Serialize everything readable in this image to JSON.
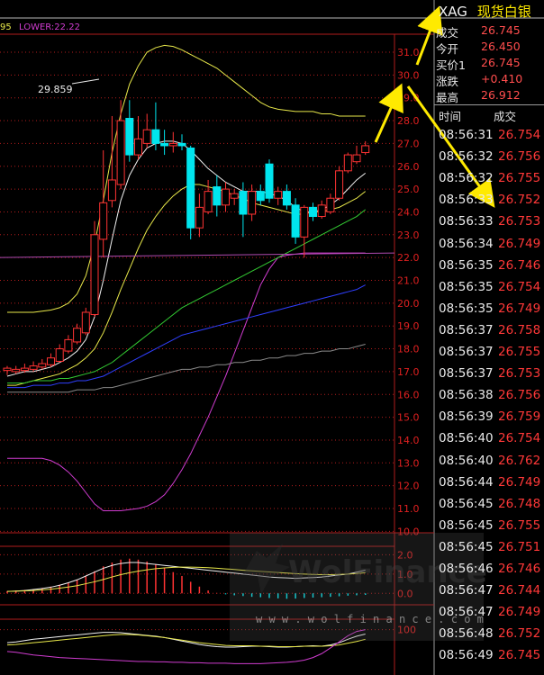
{
  "header": {
    "indicator_tail": "95",
    "lower_label": "LOWER:22.22",
    "annotation_high": "29.859"
  },
  "symbol": {
    "code": "XAG",
    "name": "现货白银"
  },
  "quote": [
    {
      "label": "成交",
      "value": "26.745"
    },
    {
      "label": "今开",
      "value": "26.450"
    },
    {
      "label": "买价1",
      "value": "26.745"
    },
    {
      "label": "涨跌",
      "value": "+0.410"
    },
    {
      "label": "最高",
      "value": "26.912"
    }
  ],
  "ticks_header": {
    "time": "时间",
    "price": "成交"
  },
  "ticks": [
    {
      "time": "08:56:31",
      "price": "26.754"
    },
    {
      "time": "08:56:32",
      "price": "26.756"
    },
    {
      "time": "08:56:32",
      "price": "26.755"
    },
    {
      "time": "08:56:33",
      "price": "26.752"
    },
    {
      "time": "08:56:33",
      "price": "26.753"
    },
    {
      "time": "08:56:34",
      "price": "26.749"
    },
    {
      "time": "08:56:35",
      "price": "26.746"
    },
    {
      "time": "08:56:35",
      "price": "26.754"
    },
    {
      "time": "08:56:35",
      "price": "26.749"
    },
    {
      "time": "08:56:37",
      "price": "26.758"
    },
    {
      "time": "08:56:37",
      "price": "26.755"
    },
    {
      "time": "08:56:37",
      "price": "26.753"
    },
    {
      "time": "08:56:38",
      "price": "26.756"
    },
    {
      "time": "08:56:39",
      "price": "26.759"
    },
    {
      "time": "08:56:40",
      "price": "26.754"
    },
    {
      "time": "08:56:40",
      "price": "26.762"
    },
    {
      "time": "08:56:44",
      "price": "26.749"
    },
    {
      "time": "08:56:45",
      "price": "26.748"
    },
    {
      "time": "08:56:45",
      "price": "26.755"
    },
    {
      "time": "08:56:45",
      "price": "26.751"
    },
    {
      "time": "08:56:46",
      "price": "26.746"
    },
    {
      "time": "08:56:47",
      "price": "26.744"
    },
    {
      "time": "08:56:47",
      "price": "26.749"
    },
    {
      "time": "08:56:48",
      "price": "26.752"
    },
    {
      "time": "08:56:49",
      "price": "26.745"
    }
  ],
  "watermark": {
    "brand": "WolFinance",
    "url": "w w w . w o l f i n a n c e . c o m"
  },
  "colors": {
    "up": "#ff3333",
    "down": "#00e5ee",
    "grid": "#b01c1c",
    "axis_label": "#e02020",
    "upper_band": "#e8e84a",
    "lower_band": "#d03cd0",
    "ma_white": "#f2f2f2",
    "ma_yellow": "#e8e84a",
    "ma_green": "#33cc33",
    "ma_blue": "#2f3fff",
    "ma_gray": "#8a8a8a",
    "arrow": "#ffea00"
  },
  "chart_data": {
    "type": "candlestick",
    "y_ticks": [
      31.0,
      30.0,
      29.0,
      28.0,
      27.0,
      26.0,
      25.0,
      24.0,
      23.0,
      22.0,
      21.0,
      20.0,
      19.0,
      18.0,
      17.0,
      16.0,
      15.0,
      14.0,
      13.0,
      12.0,
      11.0,
      10.0
    ],
    "ylim": [
      10.0,
      31.0
    ],
    "candles": [
      {
        "o": 17.05,
        "c": 17.15,
        "h": 17.25,
        "l": 16.85
      },
      {
        "o": 17.0,
        "c": 17.1,
        "h": 17.25,
        "l": 16.9
      },
      {
        "o": 17.05,
        "c": 17.15,
        "h": 17.35,
        "l": 16.95
      },
      {
        "o": 17.1,
        "c": 17.25,
        "h": 17.45,
        "l": 17.0
      },
      {
        "o": 17.2,
        "c": 17.35,
        "h": 17.55,
        "l": 17.1
      },
      {
        "o": 17.3,
        "c": 17.6,
        "h": 17.8,
        "l": 17.2
      },
      {
        "o": 17.45,
        "c": 18.0,
        "h": 18.2,
        "l": 17.4
      },
      {
        "o": 17.9,
        "c": 18.4,
        "h": 18.6,
        "l": 17.8
      },
      {
        "o": 18.3,
        "c": 18.9,
        "h": 19.1,
        "l": 18.2
      },
      {
        "o": 18.7,
        "c": 19.6,
        "h": 19.8,
        "l": 18.6
      },
      {
        "o": 19.5,
        "c": 23.0,
        "h": 23.6,
        "l": 19.4
      },
      {
        "o": 22.8,
        "c": 24.4,
        "h": 26.7,
        "l": 22.0
      },
      {
        "o": 24.5,
        "c": 25.4,
        "h": 28.2,
        "l": 24.2
      },
      {
        "o": 25.2,
        "c": 28.0,
        "h": 28.9,
        "l": 25.0
      },
      {
        "o": 28.1,
        "c": 26.5,
        "h": 28.9,
        "l": 26.2
      },
      {
        "o": 26.5,
        "c": 27.2,
        "h": 28.2,
        "l": 26.3
      },
      {
        "o": 27.0,
        "c": 27.6,
        "h": 28.3,
        "l": 26.8
      },
      {
        "o": 27.6,
        "c": 27.0,
        "h": 28.8,
        "l": 26.7
      },
      {
        "o": 27.0,
        "c": 26.9,
        "h": 27.6,
        "l": 26.5
      },
      {
        "o": 26.9,
        "c": 27.0,
        "h": 27.5,
        "l": 26.6
      },
      {
        "o": 27.0,
        "c": 26.9,
        "h": 27.4,
        "l": 26.7
      },
      {
        "o": 26.8,
        "c": 23.3,
        "h": 26.9,
        "l": 22.8
      },
      {
        "o": 23.3,
        "c": 24.2,
        "h": 24.8,
        "l": 22.9
      },
      {
        "o": 24.0,
        "c": 24.9,
        "h": 25.4,
        "l": 23.9
      },
      {
        "o": 25.1,
        "c": 24.3,
        "h": 25.6,
        "l": 23.8
      },
      {
        "o": 24.3,
        "c": 25.0,
        "h": 25.3,
        "l": 24.0
      },
      {
        "o": 24.6,
        "c": 24.8,
        "h": 25.0,
        "l": 24.3
      },
      {
        "o": 24.9,
        "c": 23.9,
        "h": 25.3,
        "l": 22.9
      },
      {
        "o": 23.9,
        "c": 24.9,
        "h": 25.2,
        "l": 23.6
      },
      {
        "o": 24.9,
        "c": 24.5,
        "h": 25.2,
        "l": 24.3
      },
      {
        "o": 26.1,
        "c": 24.6,
        "h": 26.3,
        "l": 24.4
      },
      {
        "o": 24.6,
        "c": 24.9,
        "h": 25.1,
        "l": 24.3
      },
      {
        "o": 24.9,
        "c": 24.3,
        "h": 25.2,
        "l": 24.1
      },
      {
        "o": 24.3,
        "c": 22.9,
        "h": 24.6,
        "l": 22.6
      },
      {
        "o": 22.9,
        "c": 24.2,
        "h": 24.3,
        "l": 22.0
      },
      {
        "o": 24.2,
        "c": 23.8,
        "h": 24.4,
        "l": 23.6
      },
      {
        "o": 23.8,
        "c": 24.3,
        "h": 24.5,
        "l": 23.7
      },
      {
        "o": 24.0,
        "c": 24.6,
        "h": 24.8,
        "l": 23.9
      },
      {
        "o": 24.6,
        "c": 25.8,
        "h": 26.0,
        "l": 24.5
      },
      {
        "o": 25.8,
        "c": 26.5,
        "h": 26.6,
        "l": 25.7
      },
      {
        "o": 26.2,
        "c": 26.5,
        "h": 26.9,
        "l": 26.1
      },
      {
        "o": 26.6,
        "c": 26.9,
        "h": 27.1,
        "l": 26.5
      }
    ],
    "overlays": [
      {
        "name": "upper_band",
        "color": "#e8e84a",
        "values": [
          19.6,
          19.6,
          19.6,
          19.6,
          19.65,
          19.7,
          19.8,
          20.0,
          20.4,
          21.2,
          22.6,
          24.5,
          26.6,
          28.3,
          29.6,
          30.4,
          31.0,
          31.2,
          31.3,
          31.25,
          31.1,
          30.9,
          30.7,
          30.5,
          30.3,
          30.0,
          29.7,
          29.4,
          29.1,
          28.8,
          28.6,
          28.5,
          28.45,
          28.4,
          28.4,
          28.4,
          28.3,
          28.3,
          28.2,
          28.2,
          28.2,
          28.2
        ]
      },
      {
        "name": "lower_band",
        "color": "#d03cd0",
        "values": [
          13.2,
          13.2,
          13.2,
          13.2,
          13.2,
          13.1,
          12.9,
          12.6,
          12.2,
          11.7,
          11.2,
          10.9,
          10.9,
          10.9,
          10.95,
          11.0,
          11.1,
          11.3,
          11.6,
          12.1,
          12.7,
          13.4,
          14.2,
          15.0,
          15.9,
          16.8,
          17.8,
          18.8,
          19.8,
          20.8,
          21.5,
          22.0,
          22.1,
          22.15,
          22.2,
          22.2,
          22.2,
          22.2,
          22.2,
          22.2,
          22.2,
          22.2
        ]
      },
      {
        "name": "ma_white",
        "color": "#f2f2f2",
        "values": [
          16.8,
          16.9,
          17.0,
          17.0,
          17.1,
          17.2,
          17.4,
          17.6,
          17.9,
          18.4,
          19.4,
          21.0,
          22.8,
          24.5,
          25.6,
          26.3,
          26.8,
          27.0,
          27.1,
          27.1,
          27.0,
          26.7,
          26.3,
          25.9,
          25.6,
          25.3,
          25.1,
          24.9,
          24.9,
          24.9,
          24.8,
          24.7,
          24.5,
          24.2,
          24.0,
          24.0,
          24.1,
          24.3,
          24.6,
          25.0,
          25.4,
          25.7
        ]
      },
      {
        "name": "ma_yellow",
        "color": "#e8e84a",
        "values": [
          16.4,
          16.4,
          16.5,
          16.6,
          16.7,
          16.8,
          16.9,
          17.1,
          17.3,
          17.6,
          18.0,
          18.7,
          19.6,
          20.6,
          21.5,
          22.4,
          23.2,
          23.8,
          24.3,
          24.7,
          25.0,
          25.2,
          25.2,
          25.1,
          25.0,
          24.9,
          24.7,
          24.6,
          24.4,
          24.3,
          24.2,
          24.1,
          24.0,
          23.9,
          23.9,
          24.0,
          24.0,
          24.1,
          24.2,
          24.4,
          24.6,
          24.9
        ]
      },
      {
        "name": "ma_green",
        "color": "#33cc33",
        "values": [
          16.5,
          16.5,
          16.5,
          16.6,
          16.6,
          16.6,
          16.7,
          16.7,
          16.8,
          16.9,
          17.0,
          17.2,
          17.4,
          17.7,
          18.0,
          18.3,
          18.6,
          18.9,
          19.2,
          19.5,
          19.8,
          20.0,
          20.2,
          20.4,
          20.6,
          20.8,
          21.0,
          21.2,
          21.4,
          21.6,
          21.8,
          22.0,
          22.2,
          22.4,
          22.6,
          22.8,
          23.0,
          23.2,
          23.4,
          23.6,
          23.8,
          24.1
        ]
      },
      {
        "name": "ma_blue",
        "color": "#2f3fff",
        "values": [
          16.3,
          16.3,
          16.3,
          16.4,
          16.4,
          16.4,
          16.5,
          16.5,
          16.6,
          16.6,
          16.7,
          16.8,
          17.0,
          17.2,
          17.4,
          17.6,
          17.8,
          18.0,
          18.2,
          18.4,
          18.6,
          18.7,
          18.8,
          18.9,
          19.0,
          19.1,
          19.2,
          19.3,
          19.4,
          19.5,
          19.6,
          19.7,
          19.8,
          19.9,
          20.0,
          20.1,
          20.2,
          20.3,
          20.4,
          20.5,
          20.6,
          20.8
        ]
      },
      {
        "name": "ma_gray",
        "color": "#8a8a8a",
        "values": [
          16.1,
          16.1,
          16.1,
          16.1,
          16.1,
          16.1,
          16.1,
          16.1,
          16.2,
          16.2,
          16.2,
          16.3,
          16.3,
          16.4,
          16.5,
          16.6,
          16.7,
          16.8,
          16.9,
          17.0,
          17.1,
          17.1,
          17.2,
          17.2,
          17.3,
          17.3,
          17.4,
          17.4,
          17.5,
          17.5,
          17.6,
          17.6,
          17.7,
          17.7,
          17.8,
          17.8,
          17.9,
          17.9,
          18.0,
          18.0,
          18.1,
          18.2
        ]
      }
    ],
    "support_line": {
      "from": 22.0,
      "to": 22.2,
      "color": "#b04ab0"
    },
    "macd": {
      "y_ticks": [
        2.0,
        1.0,
        0.0
      ],
      "ylim": [
        -0.5,
        2.3
      ],
      "histogram": [
        0.12,
        0.15,
        0.18,
        0.22,
        0.28,
        0.35,
        0.45,
        0.55,
        0.7,
        0.9,
        1.15,
        1.4,
        1.6,
        1.75,
        1.8,
        1.75,
        1.65,
        1.5,
        1.3,
        1.1,
        0.9,
        0.6,
        0.35,
        0.15,
        0.02,
        -0.05,
        -0.1,
        -0.14,
        -0.18,
        -0.2,
        -0.24,
        -0.26,
        -0.28,
        -0.27,
        -0.24,
        -0.22,
        -0.2,
        -0.18,
        -0.15,
        -0.12,
        -0.1,
        -0.08
      ],
      "dif": [
        0.1,
        0.12,
        0.15,
        0.2,
        0.25,
        0.32,
        0.42,
        0.55,
        0.7,
        0.9,
        1.1,
        1.3,
        1.45,
        1.55,
        1.6,
        1.6,
        1.55,
        1.5,
        1.45,
        1.4,
        1.35,
        1.3,
        1.25,
        1.2,
        1.15,
        1.1,
        1.05,
        1.0,
        0.95,
        0.9,
        0.85,
        0.82,
        0.8,
        0.78,
        0.8,
        0.82,
        0.85,
        0.9,
        0.95,
        1.0,
        1.1,
        1.2
      ],
      "dea": [
        0.1,
        0.11,
        0.13,
        0.15,
        0.18,
        0.22,
        0.27,
        0.33,
        0.4,
        0.5,
        0.6,
        0.72,
        0.85,
        0.97,
        1.07,
        1.15,
        1.22,
        1.28,
        1.32,
        1.35,
        1.36,
        1.36,
        1.35,
        1.33,
        1.3,
        1.27,
        1.24,
        1.2,
        1.17,
        1.14,
        1.11,
        1.08,
        1.05,
        1.02,
        1.0,
        0.98,
        0.97,
        0.97,
        0.98,
        1.0,
        1.03,
        1.07
      ]
    },
    "kdj": {
      "y_ticks": [
        100
      ],
      "ylim": [
        0,
        120
      ],
      "k": [
        70,
        72,
        75,
        78,
        80,
        82,
        84,
        86,
        88,
        90,
        92,
        94,
        94,
        93,
        91,
        89,
        87,
        85,
        82,
        78,
        74,
        70,
        66,
        63,
        61,
        60,
        60,
        61,
        62,
        62,
        61,
        60,
        60,
        61,
        62,
        63,
        62,
        65,
        70,
        78,
        85,
        90
      ],
      "d": [
        65,
        66,
        68,
        70,
        72,
        74,
        76,
        78,
        80,
        82,
        84,
        86,
        88,
        89,
        89,
        88,
        86,
        84,
        82,
        79,
        76,
        73,
        70,
        68,
        66,
        64,
        63,
        63,
        63,
        62,
        62,
        61,
        61,
        61,
        62,
        62,
        62,
        63,
        65,
        69,
        73,
        78
      ],
      "j": [
        50,
        48,
        45,
        42,
        40,
        38,
        36,
        35,
        34,
        33,
        32,
        31,
        30,
        29,
        28,
        27,
        27,
        26,
        26,
        25,
        25,
        24,
        24,
        23,
        23,
        23,
        22,
        22,
        22,
        22,
        23,
        24,
        25,
        27,
        30,
        36,
        45,
        58,
        72,
        86,
        96,
        100
      ]
    }
  }
}
